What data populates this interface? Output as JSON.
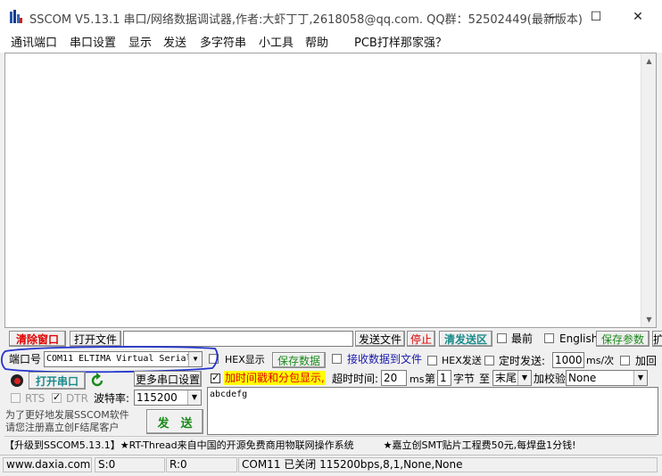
{
  "titlebar": {
    "title": "SSCOM V5.13.1 串口/网络数据调试器,作者:大虾丁丁,2618058@qq.com. QQ群：52502449(最新版本)",
    "minimize": "—",
    "maximize": "☐",
    "close": "✕"
  },
  "menu": [
    "通讯端口",
    "串口设置",
    "显示",
    "发送",
    "多字符串",
    "小工具",
    "帮助",
    "PCB打样那家强？"
  ],
  "toolbar1": {
    "clear_window": "清除窗口",
    "open_file": "打开文件",
    "file_path": "",
    "send_file": "发送文件",
    "stop": "停止",
    "clear_send": "清发送区",
    "topmost_label": "最前",
    "english_label": "English",
    "save_params": "保存参数",
    "expand": "扩"
  },
  "toolbar2": {
    "port_label": "端口号",
    "port_value": "COM11 ELTIMA Virtual Serial",
    "hex_display": "HEX显示",
    "save_data": "保存数据",
    "recv_to_file": "接收数据到文件",
    "hex_send": "HEX发送",
    "timed_send": "定时发送:",
    "interval_value": "1000",
    "interval_unit": "ms/次",
    "add_return": "加回"
  },
  "toolbar3": {
    "open_port": "打开串口",
    "more_settings": "更多串口设置",
    "timestamp_label": "加时间戳和分包显示,",
    "timeout_label": "超时时间:",
    "timeout_value": "20",
    "timeout_unit": "ms",
    "byte_prefix": "第",
    "byte_value": "1",
    "byte_label": "字节",
    "to_label": "至",
    "end_value": "末尾",
    "checksum_label": "加校验",
    "checksum_value": "None"
  },
  "toolbar4": {
    "rts": "RTS",
    "dtr": "DTR",
    "baud_label": "波特率:",
    "baud_value": "115200"
  },
  "send_area": {
    "text": "abcdefg",
    "send_button": "发　送"
  },
  "promo": {
    "line1": "为了更好地发展SSCOM软件",
    "line2": "请您注册嘉立创F结尾客户"
  },
  "ticker": "【升级到SSCOM5.13.1】★RT-Thread来自中国的开源免费商用物联网操作系统　　　★嘉立创SMT贴片工程费50元,每焊盘1分钱!",
  "status": {
    "website": "www.daxia.com",
    "sent": "S:0",
    "received": "R:0",
    "port_status": "COM11 已关闭  115200bps,8,1,None,None"
  },
  "colors": {
    "red": "#e00000",
    "green": "#1a8a1a",
    "blue": "#1a1aaa",
    "highlight": "#ffff00",
    "annotation": "#2233cc"
  }
}
